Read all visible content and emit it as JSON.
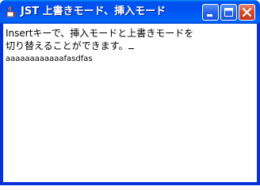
{
  "window": {
    "title": "JST 上書きモード、挿入モード",
    "icon": "java-cup-icon",
    "buttons": [
      "minimize-icon",
      "maximize-icon",
      "close-icon"
    ],
    "colors": {
      "titlebar": "#0053ee",
      "close_button": "#d5482c",
      "content_bg": "#ffffff",
      "text": "#000000"
    }
  },
  "editor": {
    "line1": "Insertキーで、挿入モードと上書きモードを",
    "line2": "切り替えることができます。",
    "line3": "aaaaaaaaaaaafasdfas"
  }
}
